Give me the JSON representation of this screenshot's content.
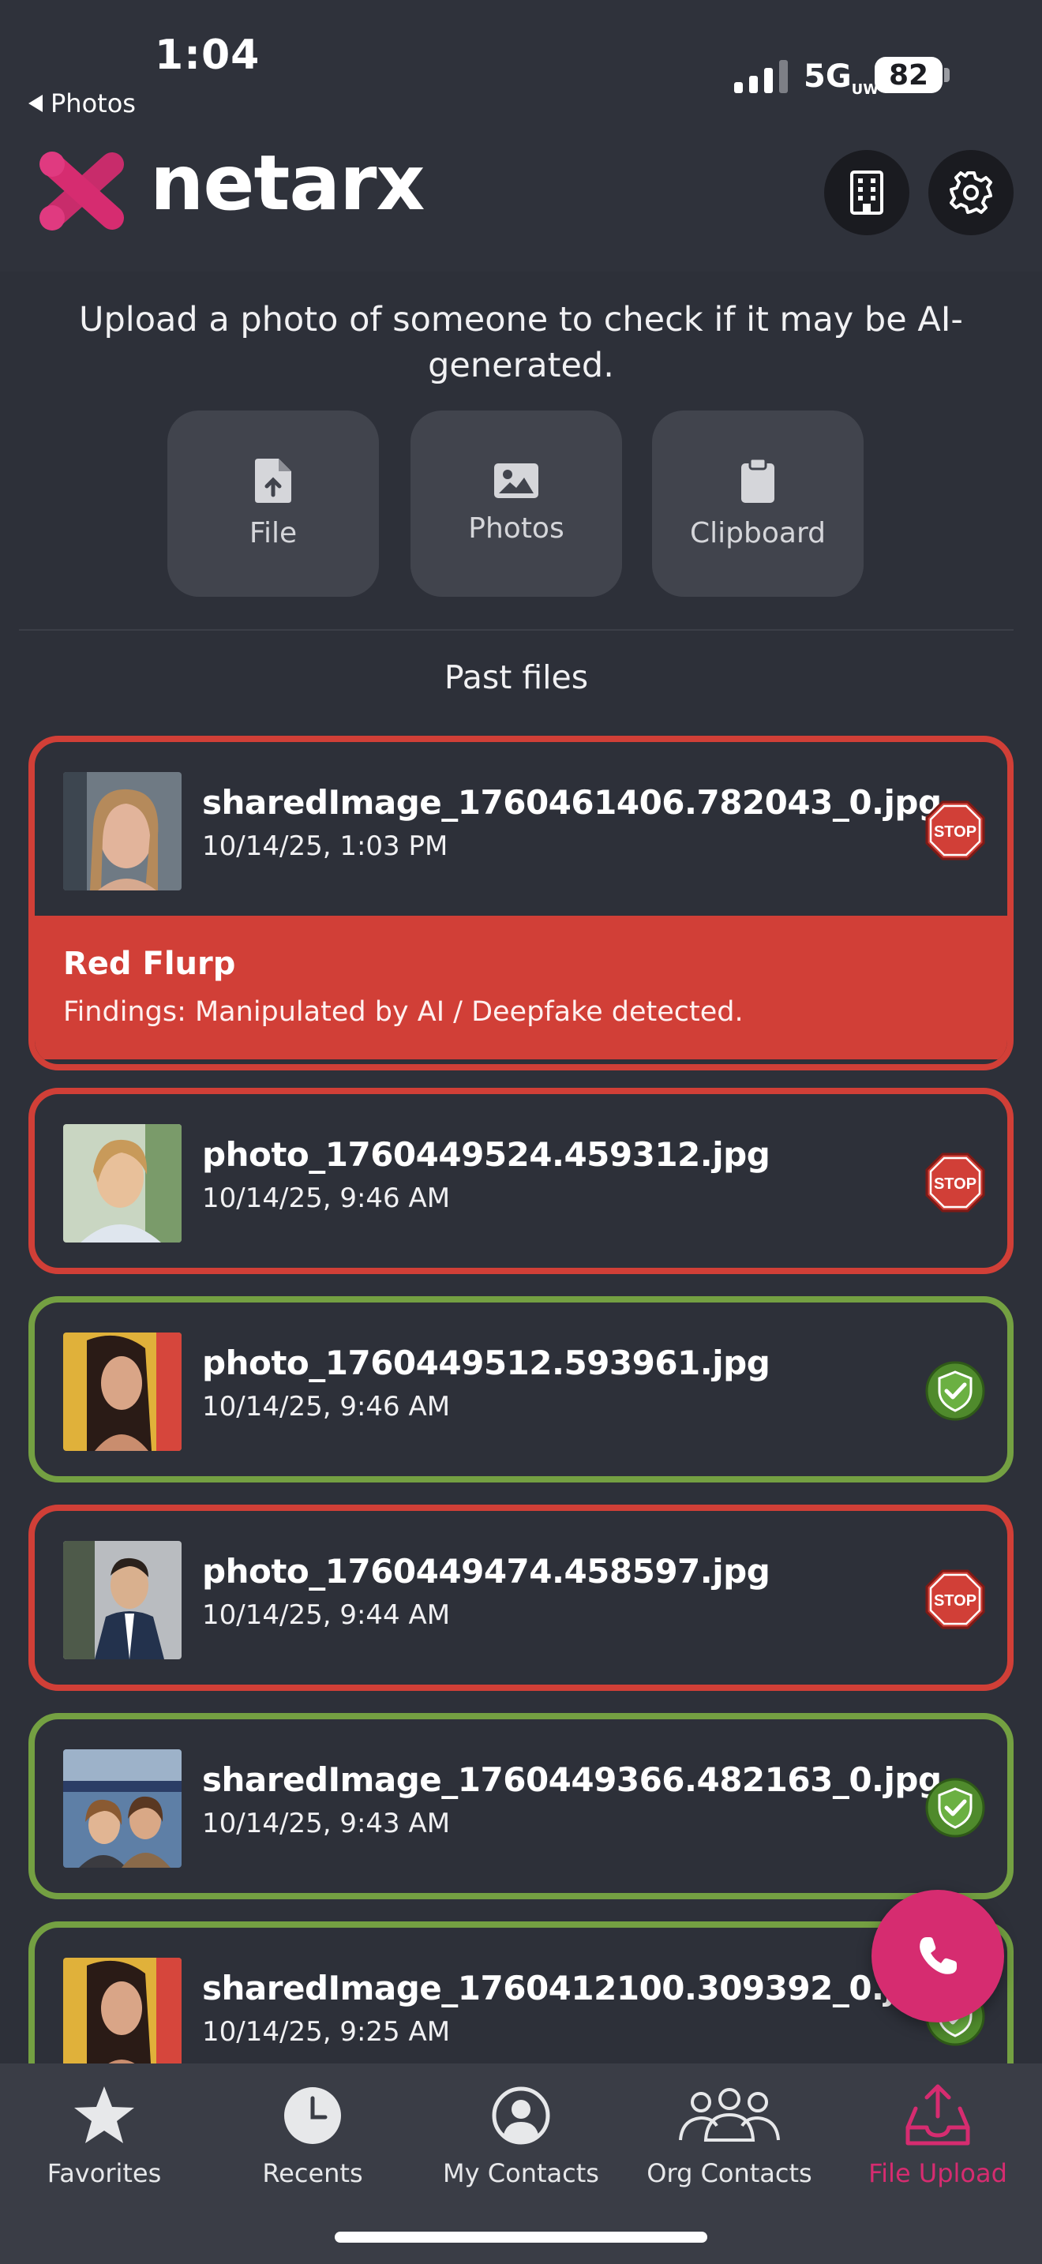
{
  "status_bar": {
    "time": "1:04",
    "back_label": "Photos",
    "network": "5G",
    "network_sub": "UW",
    "battery": "82"
  },
  "header": {
    "brand": "netarx",
    "buttons": [
      "building-icon",
      "gear-icon"
    ]
  },
  "intro": {
    "text": "Upload a photo of someone to check if it may be AI-generated.",
    "buttons": [
      {
        "label": "File",
        "icon": "file-upload-icon"
      },
      {
        "label": "Photos",
        "icon": "image-icon"
      },
      {
        "label": "Clipboard",
        "icon": "clipboard-icon"
      }
    ]
  },
  "past_files": {
    "title": "Past files",
    "items": [
      {
        "name": "sharedImage_1760461406.782043_0.jpg",
        "date": "10/14/25, 1:03 PM",
        "status": "stop",
        "findings_title": "Red Flurp",
        "findings_text": "Findings: Manipulated by AI / Deepfake detected."
      },
      {
        "name": "photo_1760449524.459312.jpg",
        "date": "10/14/25, 9:46 AM",
        "status": "stop"
      },
      {
        "name": "photo_1760449512.593961.jpg",
        "date": "10/14/25, 9:46 AM",
        "status": "safe"
      },
      {
        "name": "photo_1760449474.458597.jpg",
        "date": "10/14/25, 9:44 AM",
        "status": "stop"
      },
      {
        "name": "sharedImage_1760449366.482163_0.jpg",
        "date": "10/14/25, 9:43 AM",
        "status": "safe"
      },
      {
        "name": "sharedImage_1760412100.309392_0.jpg",
        "date": "10/14/25, 9:25 AM",
        "status": "safe"
      }
    ],
    "stop_label": "STOP"
  },
  "fab": {
    "icon": "phone-icon"
  },
  "tabs": [
    {
      "label": "Favorites",
      "icon": "star-icon"
    },
    {
      "label": "Recents",
      "icon": "clock-icon"
    },
    {
      "label": "My Contacts",
      "icon": "person-icon"
    },
    {
      "label": "Org Contacts",
      "icon": "group-icon"
    },
    {
      "label": "File Upload",
      "icon": "upload-tray-icon",
      "active": true
    }
  ],
  "colors": {
    "background": "#2d3039",
    "stop": "#d13f37",
    "safe": "#74a042",
    "accent": "#d62c70",
    "tabbar": "#3a3d46"
  }
}
